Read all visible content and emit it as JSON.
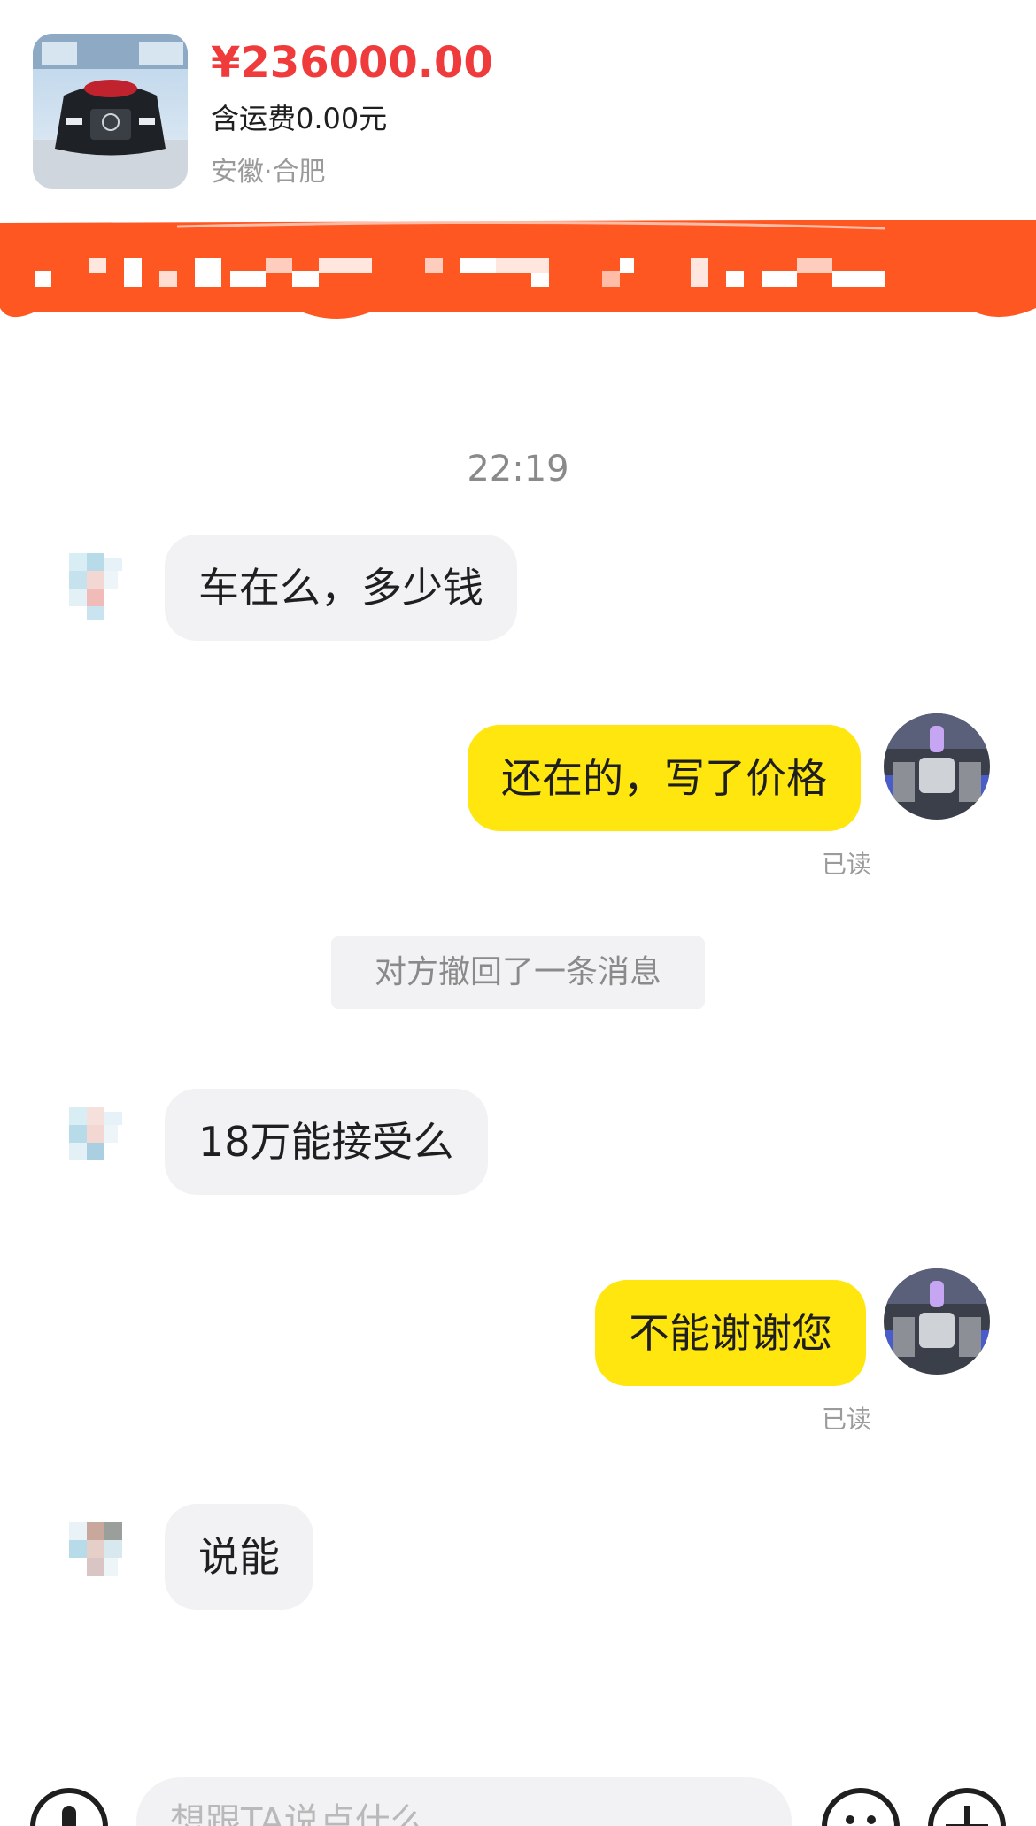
{
  "product": {
    "price": "¥236000.00",
    "shipping": "含运费0.00元",
    "location": "安徽·合肥"
  },
  "colors": {
    "accent_red": "#ef3b3b",
    "banner_orange": "#ff5722",
    "my_bubble": "#ffe60f",
    "their_bubble": "#f2f2f4"
  },
  "chat": {
    "timestamp": "22:19",
    "messages": [
      {
        "side": "in",
        "text": "车在么，多少钱"
      },
      {
        "side": "out",
        "text": "还在的，写了价格",
        "status": "已读"
      },
      {
        "side": "system",
        "text": "对方撤回了一条消息"
      },
      {
        "side": "in",
        "text": "18万能接受么"
      },
      {
        "side": "out",
        "text": "不能谢谢您",
        "status": "已读"
      },
      {
        "side": "in",
        "text": "说能"
      }
    ]
  },
  "input": {
    "placeholder": "想跟TA说点什么",
    "left_icon": "voice-icon",
    "right_icons": [
      "emoji-icon",
      "plus-icon"
    ]
  }
}
